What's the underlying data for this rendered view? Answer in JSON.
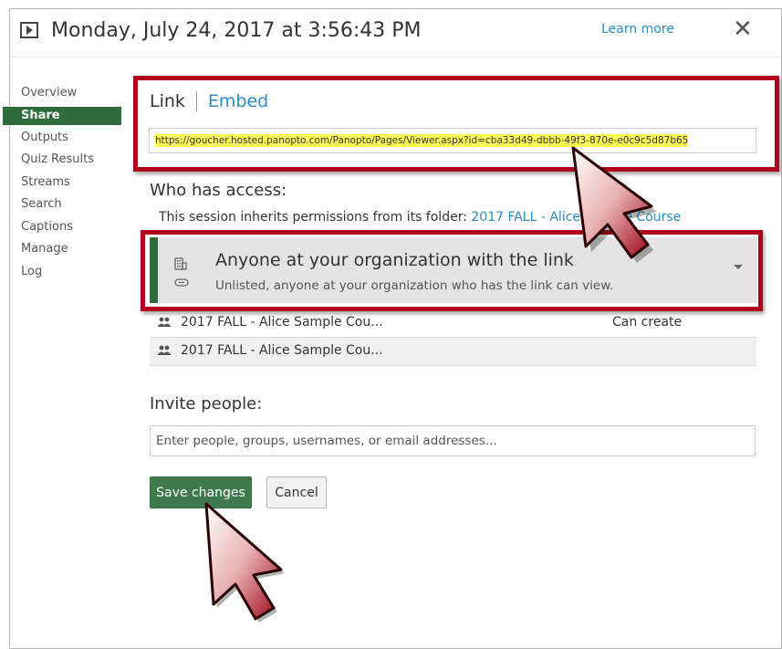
{
  "header": {
    "title": "Monday, July 24, 2017 at 3:56:43 PM",
    "learn_more": "Learn more",
    "close_glyph": "✕"
  },
  "sidebar": {
    "items": [
      {
        "label": "Overview"
      },
      {
        "label": "Share",
        "active": true
      },
      {
        "label": "Outputs"
      },
      {
        "label": "Quiz Results"
      },
      {
        "label": "Streams"
      },
      {
        "label": "Search"
      },
      {
        "label": "Captions"
      },
      {
        "label": "Manage"
      },
      {
        "label": "Log"
      }
    ]
  },
  "share": {
    "tabs": {
      "link": "Link",
      "embed": "Embed"
    },
    "url": "https://goucher.hosted.panopto.com/Panopto/Pages/Viewer.aspx?id=cba33d49-dbbb-49f3-870e-e0c9c5d87b65",
    "who_has_access": "Who has access:",
    "inherit_text": "This session inherits permissions from its folder: ",
    "inherit_folder": "2017 FALL - Alice Sample Course",
    "access": {
      "title": "Anyone at your organization with the link",
      "subtitle": "Unlisted, anyone at your organization who has the link can view."
    },
    "permissions": [
      {
        "name": "2017 FALL - Alice Sample Cou...",
        "role": "Can create"
      },
      {
        "name": "2017 FALL - Alice Sample Cou...",
        "role": ""
      }
    ],
    "invite_label": "Invite people:",
    "invite_placeholder": "Enter people, groups, usernames, or email addresses...",
    "save_label": "Save changes",
    "cancel_label": "Cancel"
  },
  "colors": {
    "accent_green": "#2f6e3c",
    "link_blue": "#2a8bc6",
    "highlight_red": "#b0001c",
    "url_highlight": "#fdfa55"
  },
  "icons": [
    "play-icon",
    "close-icon",
    "building-icon",
    "link-icon",
    "group-icon",
    "chevron-down-icon",
    "cursor-arrow-icon"
  ]
}
